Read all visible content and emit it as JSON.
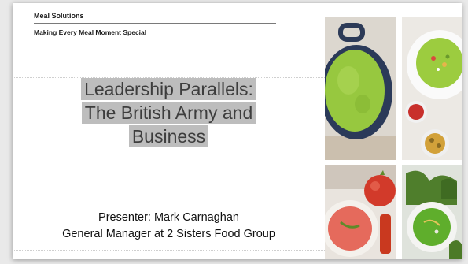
{
  "header": {
    "company": "Meal Solutions",
    "tagline": "Making Every Meal Moment Special"
  },
  "title": {
    "line1": "Leadership Parallels:",
    "line2": "The British Army  and",
    "line3": "Business"
  },
  "presenter": {
    "line1": "Presenter: Mark Carnaghan",
    "line2": "General Manager at 2 Sisters Food Group"
  },
  "photos": [
    {
      "icon": "green-soup-pot-photo"
    },
    {
      "icon": "green-soup-bowl-photo"
    },
    {
      "icon": "tomato-soup-photo"
    },
    {
      "icon": "kale-soup-photo"
    }
  ],
  "colors": {
    "title_highlight": "#bdbdbd",
    "title_text": "#3d3d3d",
    "pea_green": "#8fc33a",
    "tomato_red": "#d94b3a"
  }
}
